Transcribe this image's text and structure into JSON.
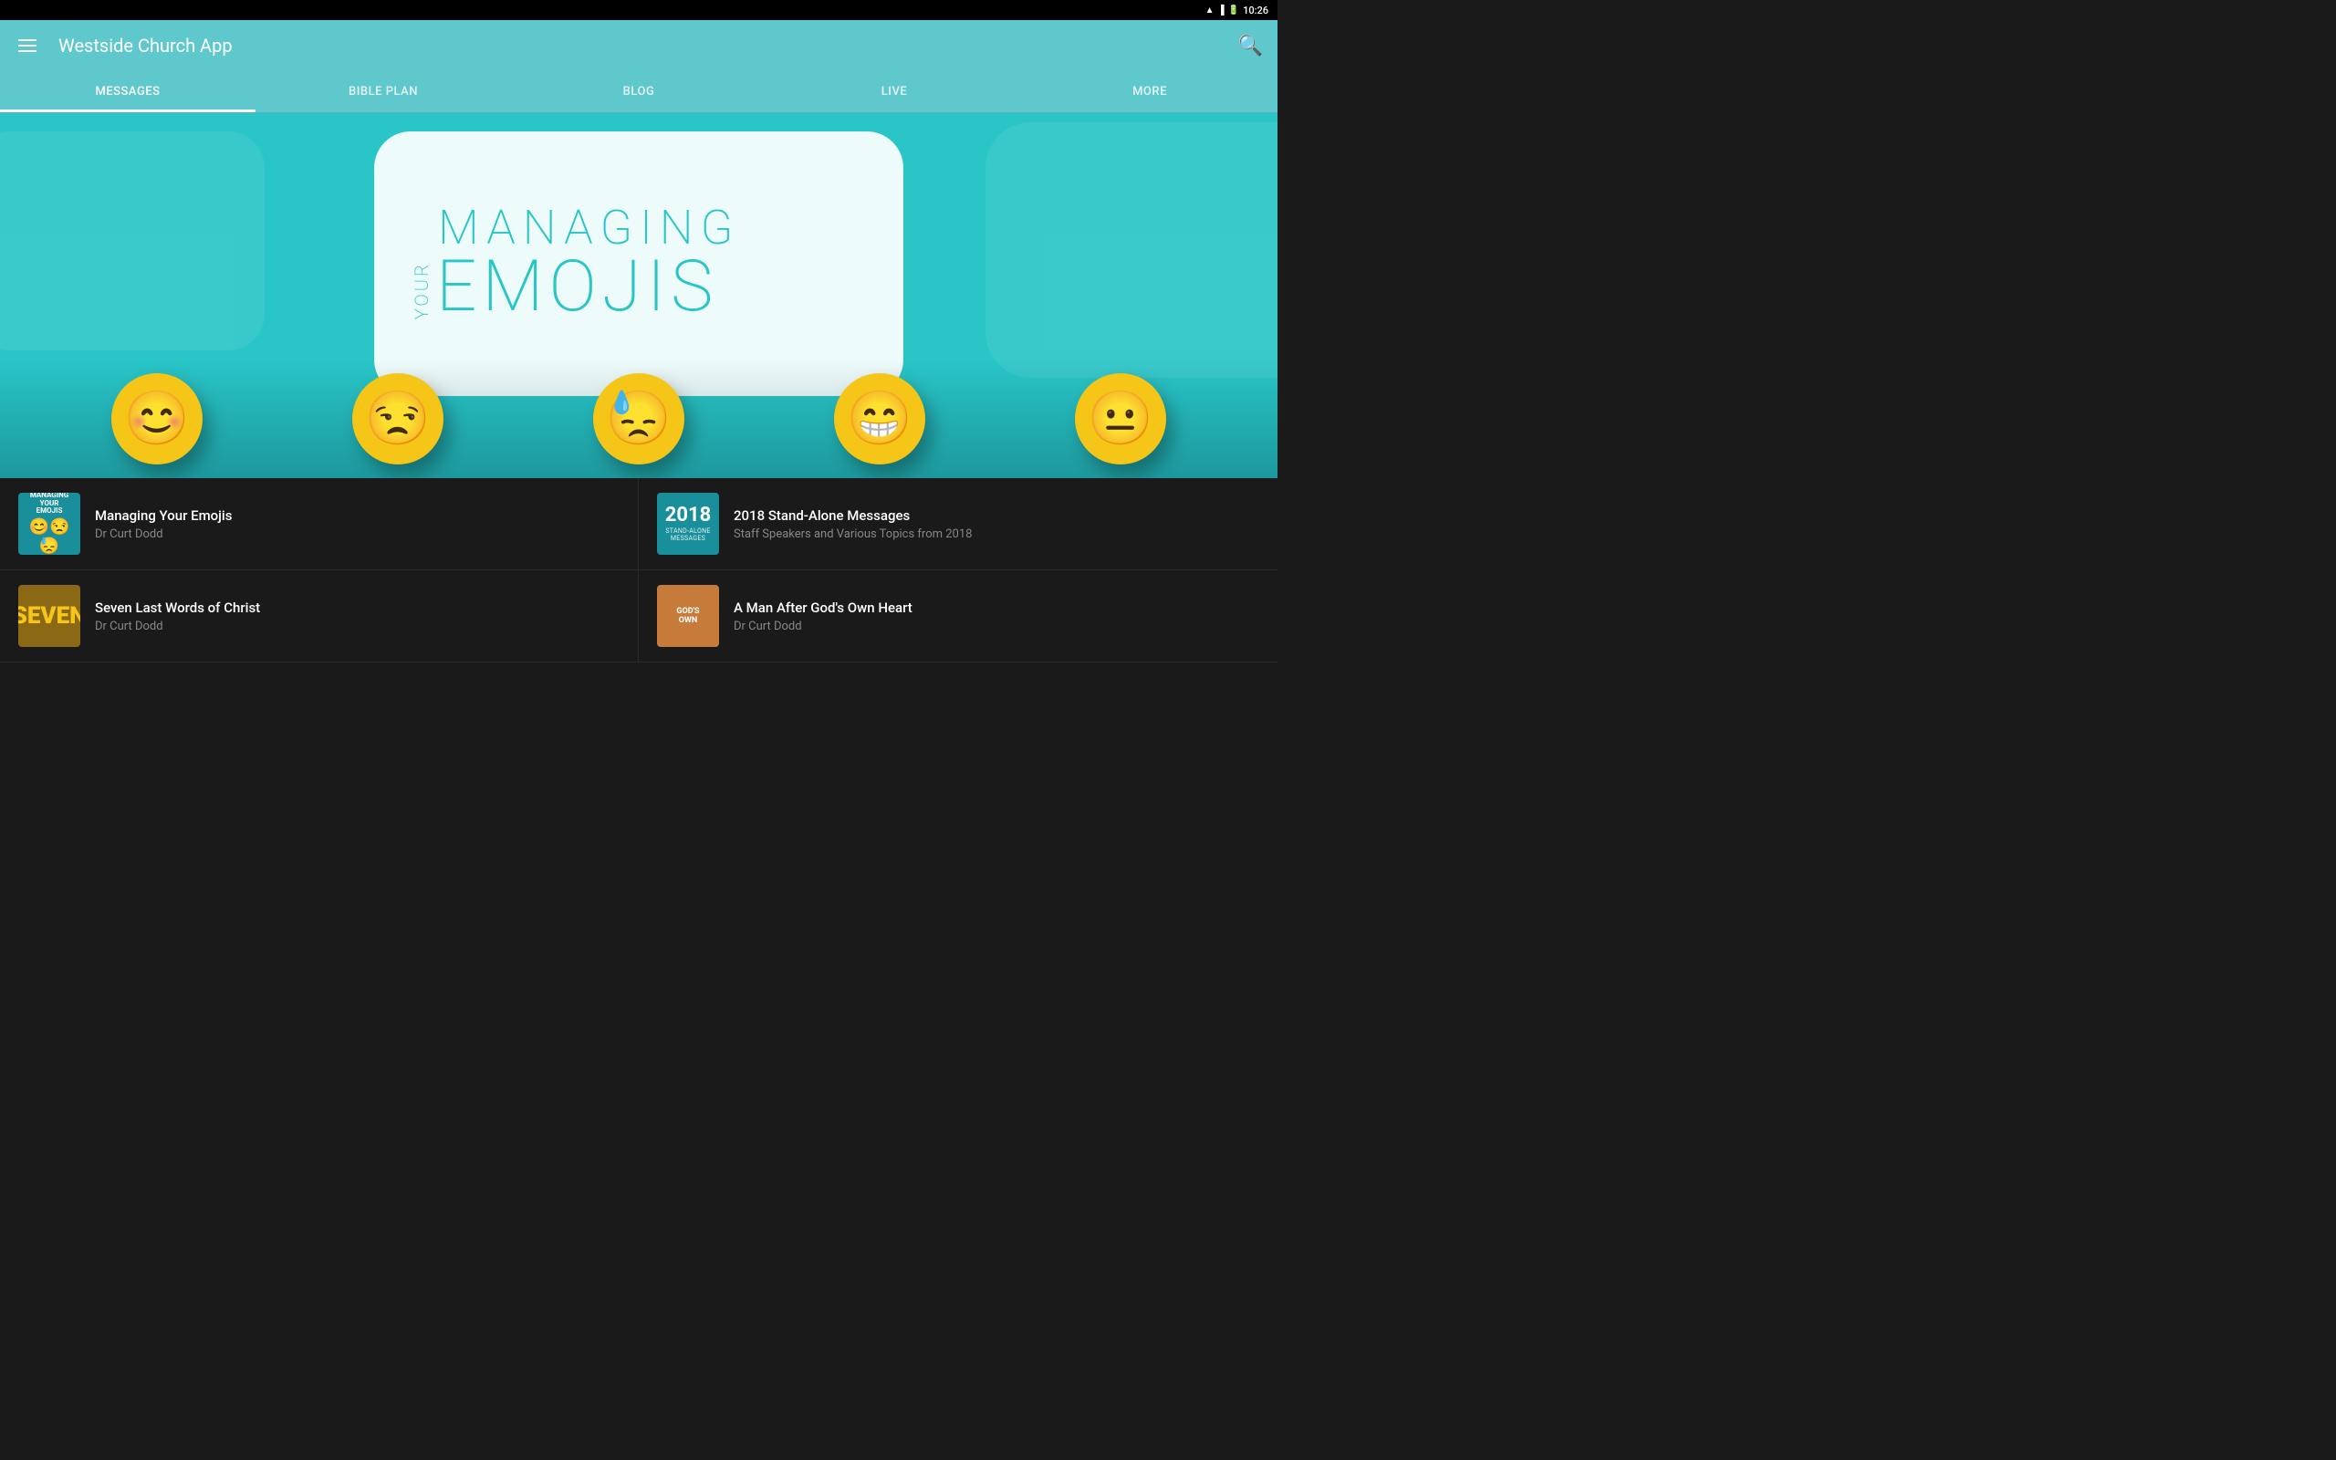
{
  "statusBar": {
    "time": "10:26",
    "icons": [
      "wifi",
      "signal",
      "battery"
    ]
  },
  "appBar": {
    "title": "Westside Church App",
    "menuIcon": "hamburger-menu",
    "searchIcon": "search"
  },
  "tabs": [
    {
      "id": "messages",
      "label": "MESSAGES",
      "active": true
    },
    {
      "id": "bible-plan",
      "label": "BIBLE PLAN",
      "active": false
    },
    {
      "id": "blog",
      "label": "BLOG",
      "active": false
    },
    {
      "id": "live",
      "label": "LIVE",
      "active": false
    },
    {
      "id": "more",
      "label": "MORE",
      "active": false
    }
  ],
  "hero": {
    "title_managing": "MANAGING",
    "title_your": "YOUR",
    "title_emojis": "EMOJIS",
    "emojis": [
      {
        "char": "😊",
        "label": "blush-smile"
      },
      {
        "char": "😒",
        "label": "unamused"
      },
      {
        "char": "😓",
        "label": "sweat-sad"
      },
      {
        "char": "😁",
        "label": "grin"
      },
      {
        "char": "😐",
        "label": "neutral"
      }
    ]
  },
  "contentList": [
    {
      "id": "managing-emojis",
      "title": "Managing Your Emojis",
      "subtitle": "Dr Curt Dodd",
      "thumbnailType": "emojis"
    },
    {
      "id": "2018-standalone",
      "title": "2018 Stand-Alone Messages",
      "subtitle": "Staff Speakers and Various Topics from 2018",
      "thumbnailType": "2018"
    },
    {
      "id": "seven-words",
      "title": "Seven Last Words of Christ",
      "subtitle": "Dr Curt Dodd",
      "thumbnailType": "seven"
    },
    {
      "id": "mans-own-heart",
      "title": "A Man After God's Own Heart",
      "subtitle": "Dr Curt Dodd",
      "thumbnailType": "godsown"
    }
  ],
  "colors": {
    "teal": "#5ec8cc",
    "darkBg": "#1a1a1a",
    "heroBg": "#29c5c7",
    "gold": "#f5c518"
  }
}
